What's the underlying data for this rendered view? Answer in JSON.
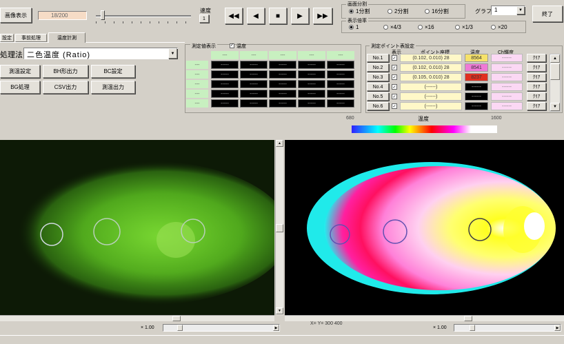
{
  "toolbar": {
    "start_button": "画像表示",
    "frame_counter": "18/200",
    "speed_label": "速度",
    "step_button": "1",
    "nav_first": "◀◀",
    "nav_prev": "◀",
    "nav_stop": "■",
    "nav_next": "▶",
    "nav_last": "▶▶",
    "end_button": "終了"
  },
  "display_group": {
    "title": "画面分割",
    "options": [
      "1分割",
      "2分割",
      "16分割"
    ],
    "selected_index": 0
  },
  "zoom_group": {
    "title": "表示倍率",
    "options": [
      "1",
      "×4/3",
      "×16",
      "×1/3",
      "×20",
      "×100"
    ],
    "selected_index": 0
  },
  "graph_select": {
    "label": "グラフ",
    "value": "1"
  },
  "tabs": [
    "設定",
    "事前処理",
    "温度計測"
  ],
  "active_tab_index": 2,
  "method_select": {
    "label": "処理法",
    "value": "二色温度 (Ratio)"
  },
  "buttons": [
    "測温設定",
    "BH形出力",
    "BC設定",
    "BG処理",
    "CSV出力",
    "測温出力"
  ],
  "grid_panel": {
    "title": "測定値表示",
    "checkbox_label": "温度",
    "col_headers": [
      "---",
      "---",
      "---",
      "---",
      "---"
    ],
    "row_headers": [
      "---",
      "---",
      "---",
      "---",
      "---"
    ],
    "cell_value": "-----"
  },
  "point_panel": {
    "title": "測定ポイント表設定",
    "headers": [
      "表示",
      "ポイント座標",
      "温度",
      "Ch輝度"
    ],
    "rows": [
      {
        "label": "No.1",
        "coord": "(0.102, 0.010) 28",
        "temp": "8564",
        "temp_color": "#f6e26a",
        "ch": "------",
        "button": "ｸﾘｱ"
      },
      {
        "label": "No.2",
        "coord": "(0.102, 0.010) 28",
        "temp": "8541",
        "temp_color": "#ef7ad6",
        "ch": "------",
        "button": "ｸﾘｱ"
      },
      {
        "label": "No.3",
        "coord": "(0.105, 0.010) 28",
        "temp": "8237",
        "temp_color": "#e03020",
        "ch": "------",
        "button": "ｸﾘｱ"
      },
      {
        "label": "No.4",
        "coord": "(------)",
        "temp": "------",
        "temp_color": "#000000",
        "ch": "------",
        "button": "ｸﾘｱ"
      },
      {
        "label": "No.5",
        "coord": "(------)",
        "temp": "------",
        "temp_color": "#000000",
        "ch": "------",
        "button": "ｸﾘｱ"
      },
      {
        "label": "No.6",
        "coord": "(------)",
        "temp": "------",
        "temp_color": "#000000",
        "ch": "------",
        "button": "ｸﾘｱ"
      }
    ]
  },
  "colorbar": {
    "min_label": "680",
    "title": "温度",
    "max_label": "1600"
  },
  "bottom_left": {
    "zoom": "× 1.00"
  },
  "bottom_right": {
    "info": "X=  Y=  300  400",
    "zoom": "× 1.00"
  }
}
